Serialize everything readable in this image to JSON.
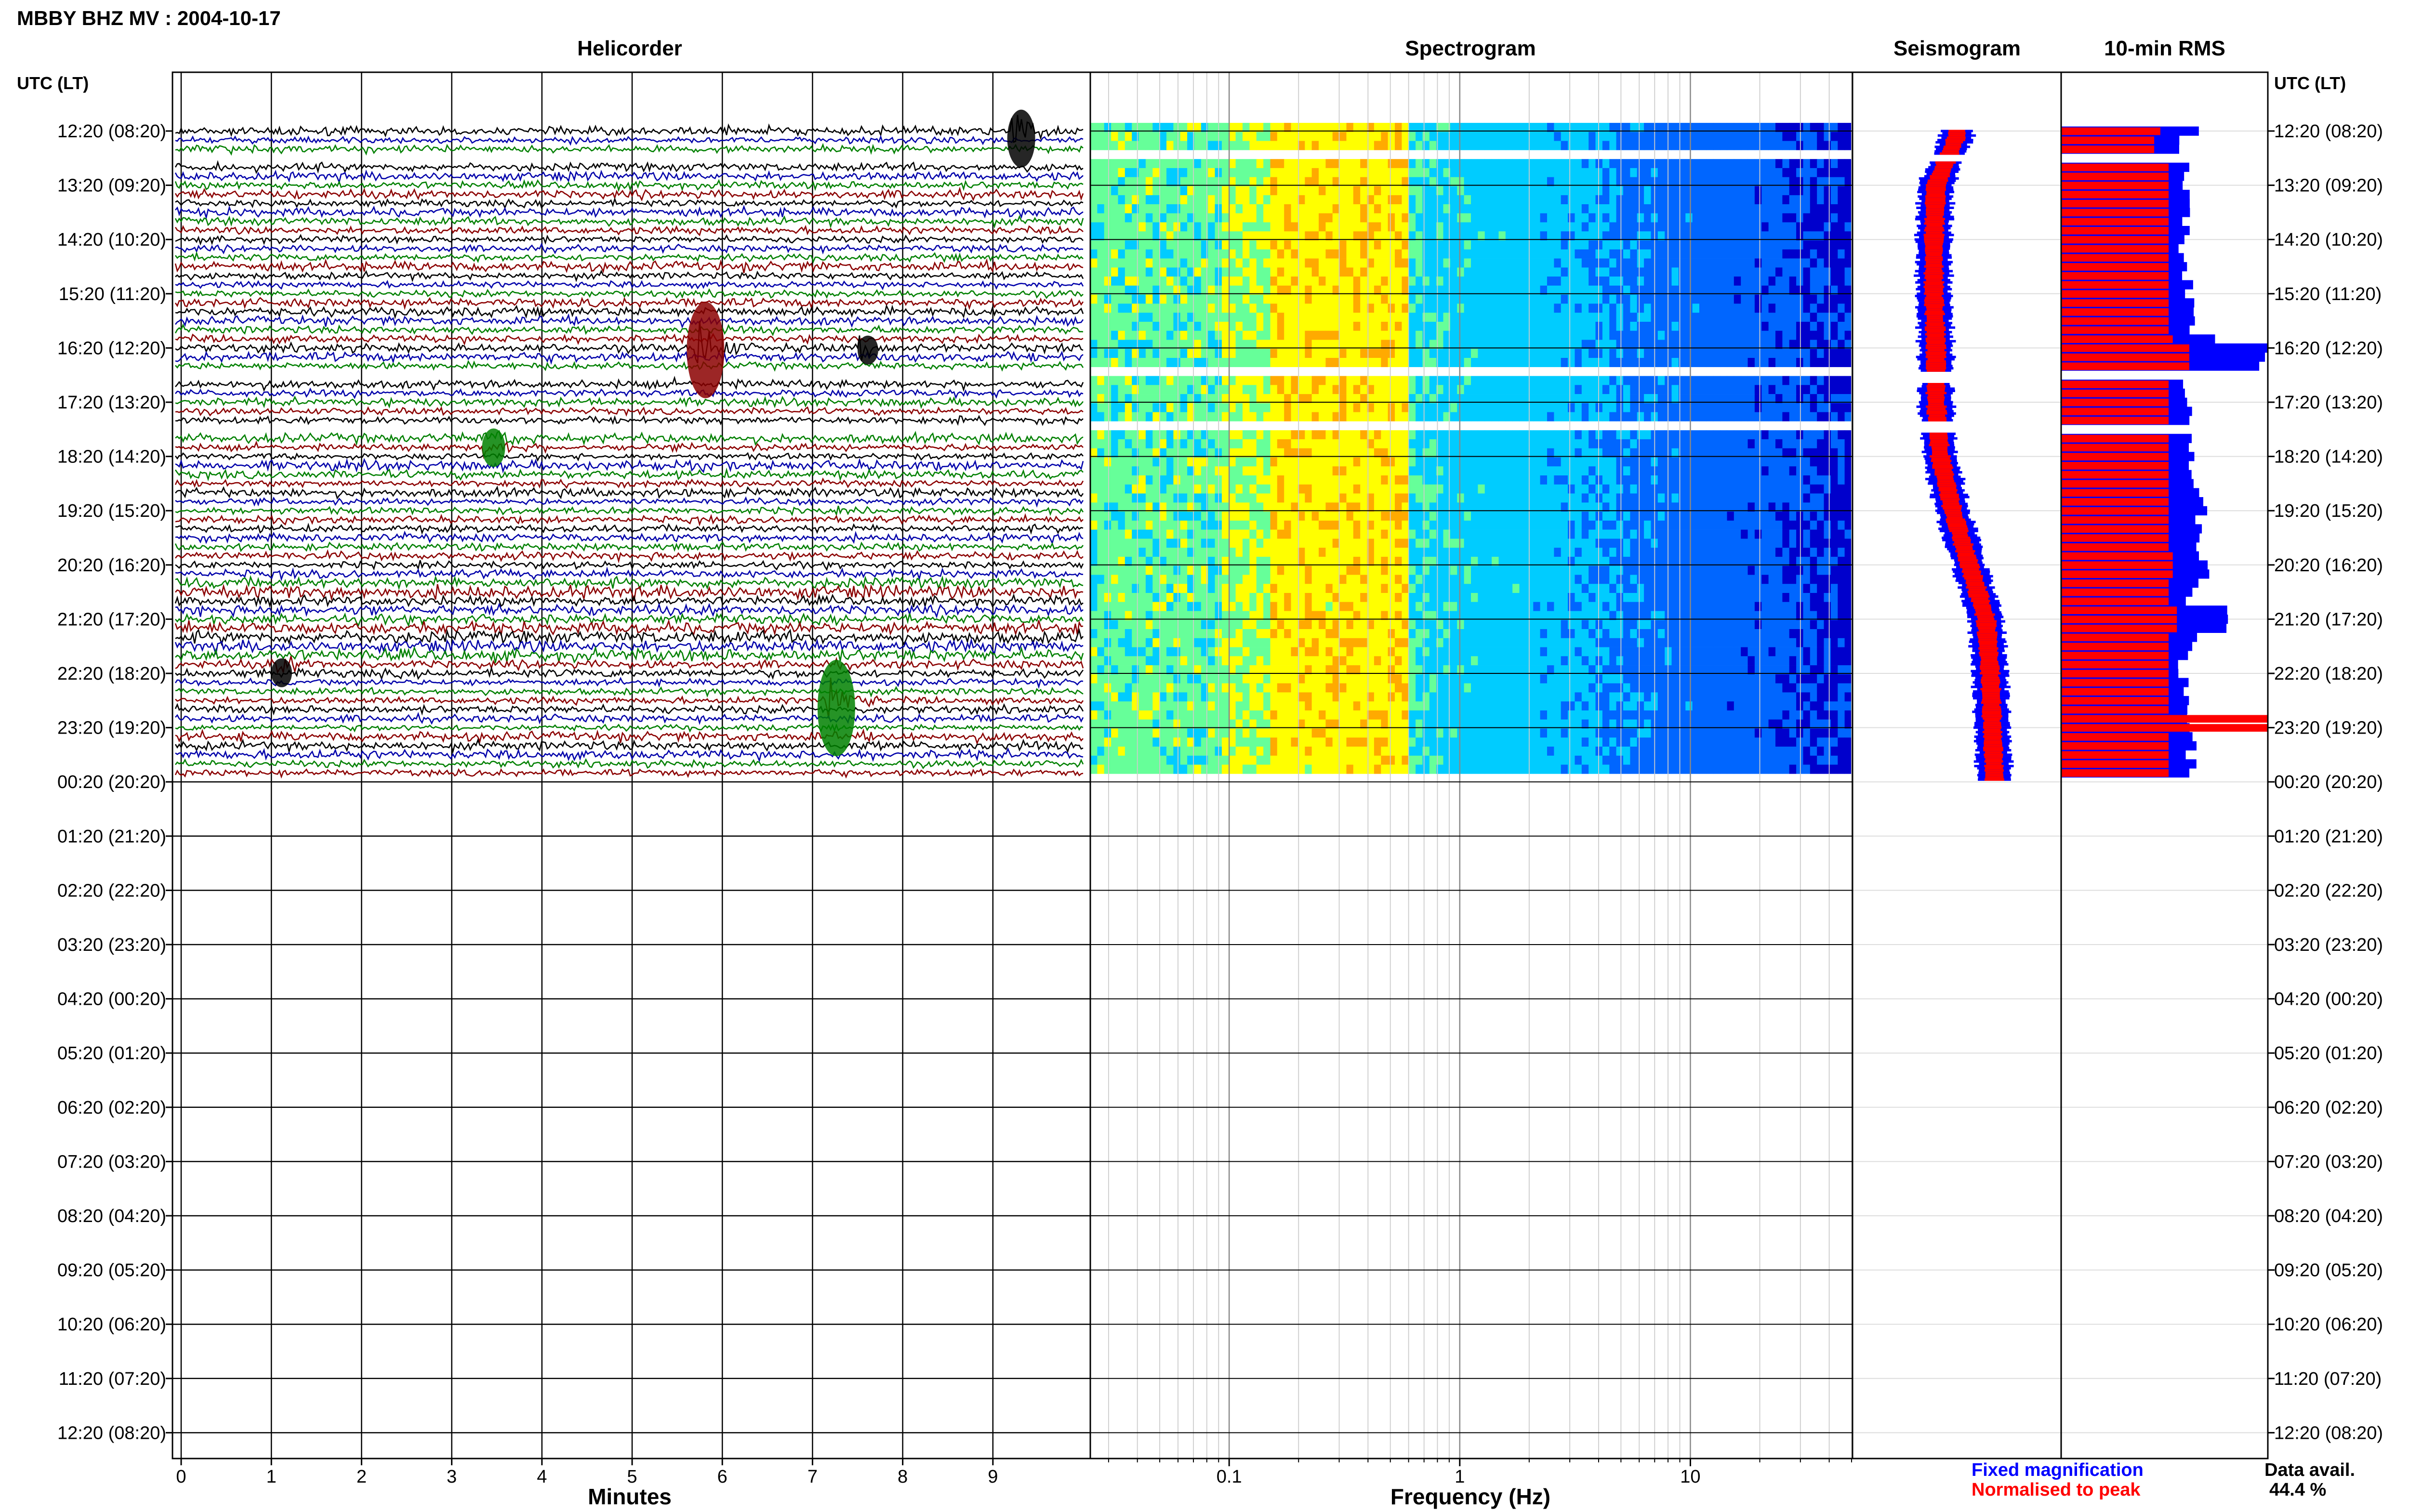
{
  "header": {
    "title": "MBBY BHZ MV : 2004-10-17"
  },
  "axes_label_left": "UTC (LT)",
  "axes_label_right": "UTC (LT)",
  "panels": {
    "helicorder": "Helicorder",
    "spectrogram": "Spectrogram",
    "seismogram": "Seismogram",
    "rms": "10-min RMS"
  },
  "xlabels": {
    "helicorder": "Minutes",
    "spectrogram": "Frequency (Hz)"
  },
  "legend": {
    "fixed": "Fixed magnification",
    "normalised": "Normalised to peak",
    "fixed_color": "#0000ff",
    "normalised_color": "#ff0000"
  },
  "data_avail": {
    "label": "Data avail.",
    "value": "44.4 %"
  },
  "chart_data": [
    {
      "type": "line",
      "title": "Helicorder",
      "xlabel": "Minutes",
      "x_ticks": [
        "0",
        "1",
        "2",
        "3",
        "4",
        "5",
        "6",
        "7",
        "8",
        "9"
      ],
      "xlim": [
        0,
        10
      ],
      "trace_colors": [
        "#000000",
        "#0000aa",
        "#008000",
        "#8b0000"
      ],
      "time_labels": [
        "12:20 (08:20)",
        "13:20 (09:20)",
        "14:20 (10:20)",
        "15:20 (11:20)",
        "16:20 (12:20)",
        "17:20 (13:20)",
        "18:20 (14:20)",
        "19:20 (15:20)",
        "20:20 (16:20)",
        "21:20 (17:20)",
        "22:20 (18:20)",
        "23:20 (19:20)",
        "00:20 (20:20)",
        "01:20 (21:20)",
        "02:20 (22:20)",
        "03:20 (23:20)",
        "04:20 (00:20)",
        "05:20 (01:20)",
        "06:20 (02:20)",
        "07:20 (03:20)",
        "08:20 (04:20)",
        "09:20 (05:20)",
        "10:20 (06:20)",
        "11:20 (07:20)",
        "12:20 (08:20)"
      ],
      "data_rows_hours": 12,
      "gaps_hours": [
        [
          0.45,
          0.55
        ],
        [
          4.45,
          4.65
        ],
        [
          5.35,
          5.55
        ]
      ],
      "events": [
        {
          "hour": 0.05,
          "minute": 9.25,
          "amp": 3.0,
          "color": "#000000"
        },
        {
          "hour": 3.95,
          "minute": 5.75,
          "amp": 5.0,
          "color": "#8b0000"
        },
        {
          "hour": 3.95,
          "minute": 7.55,
          "amp": 1.5,
          "color": "#000000"
        },
        {
          "hour": 5.75,
          "minute": 3.4,
          "amp": 2.0,
          "color": "#008000"
        },
        {
          "hour": 10.55,
          "minute": 7.2,
          "amp": 5.0,
          "color": "#008000"
        },
        {
          "hour": 9.9,
          "minute": 1.05,
          "amp": 1.5,
          "color": "#000000"
        }
      ]
    },
    {
      "type": "heatmap",
      "title": "Spectrogram",
      "xlabel": "Frequency (Hz)",
      "x_scale": "log",
      "xlim": [
        0.025,
        50
      ],
      "x_ticks": [
        "0.1",
        "1",
        "10"
      ],
      "colormap": [
        "#0000cc",
        "#0066ff",
        "#00ccff",
        "#66ff99",
        "#ffff00",
        "#ffaa00"
      ],
      "peak_band_hz": [
        0.15,
        0.6
      ],
      "data_rows_hours": 12
    },
    {
      "type": "line",
      "title": "Seismogram",
      "series": [
        {
          "name": "Fixed magnification",
          "color": "#0000ff"
        },
        {
          "name": "Normalised to peak",
          "color": "#ff0000"
        }
      ],
      "path_hours": [
        0.1,
        1.0,
        2.0,
        3.0,
        4.0,
        5.0,
        6.0,
        7.0,
        8.0,
        9.0,
        10.0,
        11.0,
        11.9
      ],
      "path_center": [
        0.5,
        0.4,
        0.39,
        0.39,
        0.4,
        0.4,
        0.42,
        0.48,
        0.56,
        0.64,
        0.66,
        0.67,
        0.68
      ]
    },
    {
      "type": "bar",
      "title": "10-min RMS",
      "series": [
        {
          "name": "Fixed magnification",
          "color": "#0000ff"
        },
        {
          "name": "Normalised to peak",
          "color": "#ff0000"
        }
      ],
      "bar_hours": [
        0.0,
        0.25,
        1.0,
        1.5,
        2.0,
        2.5,
        3.0,
        3.5,
        3.9,
        4.1,
        5.0,
        5.2,
        6.0,
        6.5,
        7.0,
        7.5,
        8.0,
        8.5,
        9.0,
        9.5,
        10.0,
        10.5,
        10.9,
        11.2,
        11.5,
        11.8
      ],
      "fixed_values": [
        0.65,
        0.55,
        0.6,
        0.62,
        0.6,
        0.61,
        0.63,
        0.64,
        0.72,
        0.98,
        0.6,
        0.62,
        0.62,
        0.66,
        0.68,
        0.68,
        0.7,
        0.64,
        0.78,
        0.65,
        0.6,
        0.62,
        0.6,
        0.66,
        0.62,
        0.63
      ],
      "normalised_values": [
        0.48,
        0.45,
        0.52,
        0.52,
        0.52,
        0.52,
        0.52,
        0.52,
        0.54,
        0.62,
        0.52,
        0.52,
        0.52,
        0.52,
        0.52,
        0.52,
        0.54,
        0.52,
        0.56,
        0.52,
        0.52,
        0.52,
        1.0,
        0.52,
        0.52,
        0.52
      ]
    }
  ]
}
